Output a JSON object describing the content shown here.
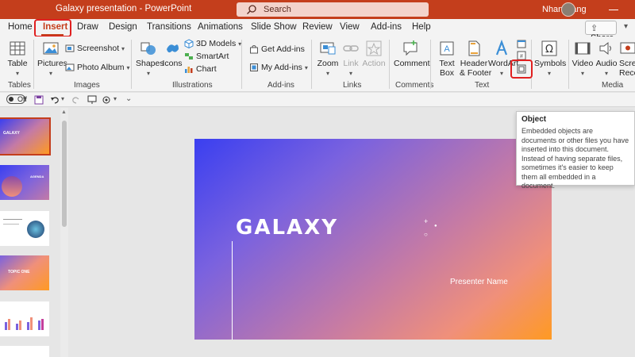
{
  "titlebar": {
    "title": "Galaxy presentation  -  PowerPoint",
    "search": "Search",
    "user": "Nhan Dang"
  },
  "tabs": [
    "Home",
    "Insert",
    "Draw",
    "Design",
    "Transitions",
    "Animations",
    "Slide Show",
    "Review",
    "View",
    "Add-ins",
    "Help"
  ],
  "share_label": "Share",
  "ribbon": {
    "table": "Table",
    "pictures": "Pictures",
    "screenshot": "Screenshot",
    "photo_album": "Photo Album",
    "shapes": "Shapes",
    "icons": "Icons",
    "models3d": "3D Models",
    "smartart": "SmartArt",
    "chart": "Chart",
    "get_addins": "Get Add-ins",
    "my_addins": "My Add-ins",
    "zoom": "Zoom",
    "link": "Link",
    "action": "Action",
    "comment": "Comment",
    "textbox": [
      "Text",
      "Box"
    ],
    "header_footer": [
      "Header",
      "& Footer"
    ],
    "wordart": "WordArt",
    "symbols": "Symbols",
    "video": "Video",
    "audio": "Audio",
    "screen_recording": [
      "Scre",
      "Reco"
    ]
  },
  "groups": [
    "Tables",
    "Images",
    "Illustrations",
    "Add-ins",
    "Links",
    "Comments",
    "Text",
    "Media"
  ],
  "qat": {
    "autosave": "Off"
  },
  "thumbnails": {
    "t1": "GALAXY",
    "t2": "AGENDA",
    "t4": "TOPIC ONE"
  },
  "slide": {
    "title": "GALAXY",
    "presenter": "Presenter Name"
  },
  "tooltip": {
    "title": "Object",
    "body": "Embedded objects are documents or other files you have inserted into this document. Instead of having separate files, sometimes it's easier to keep them all embedded in a document."
  }
}
